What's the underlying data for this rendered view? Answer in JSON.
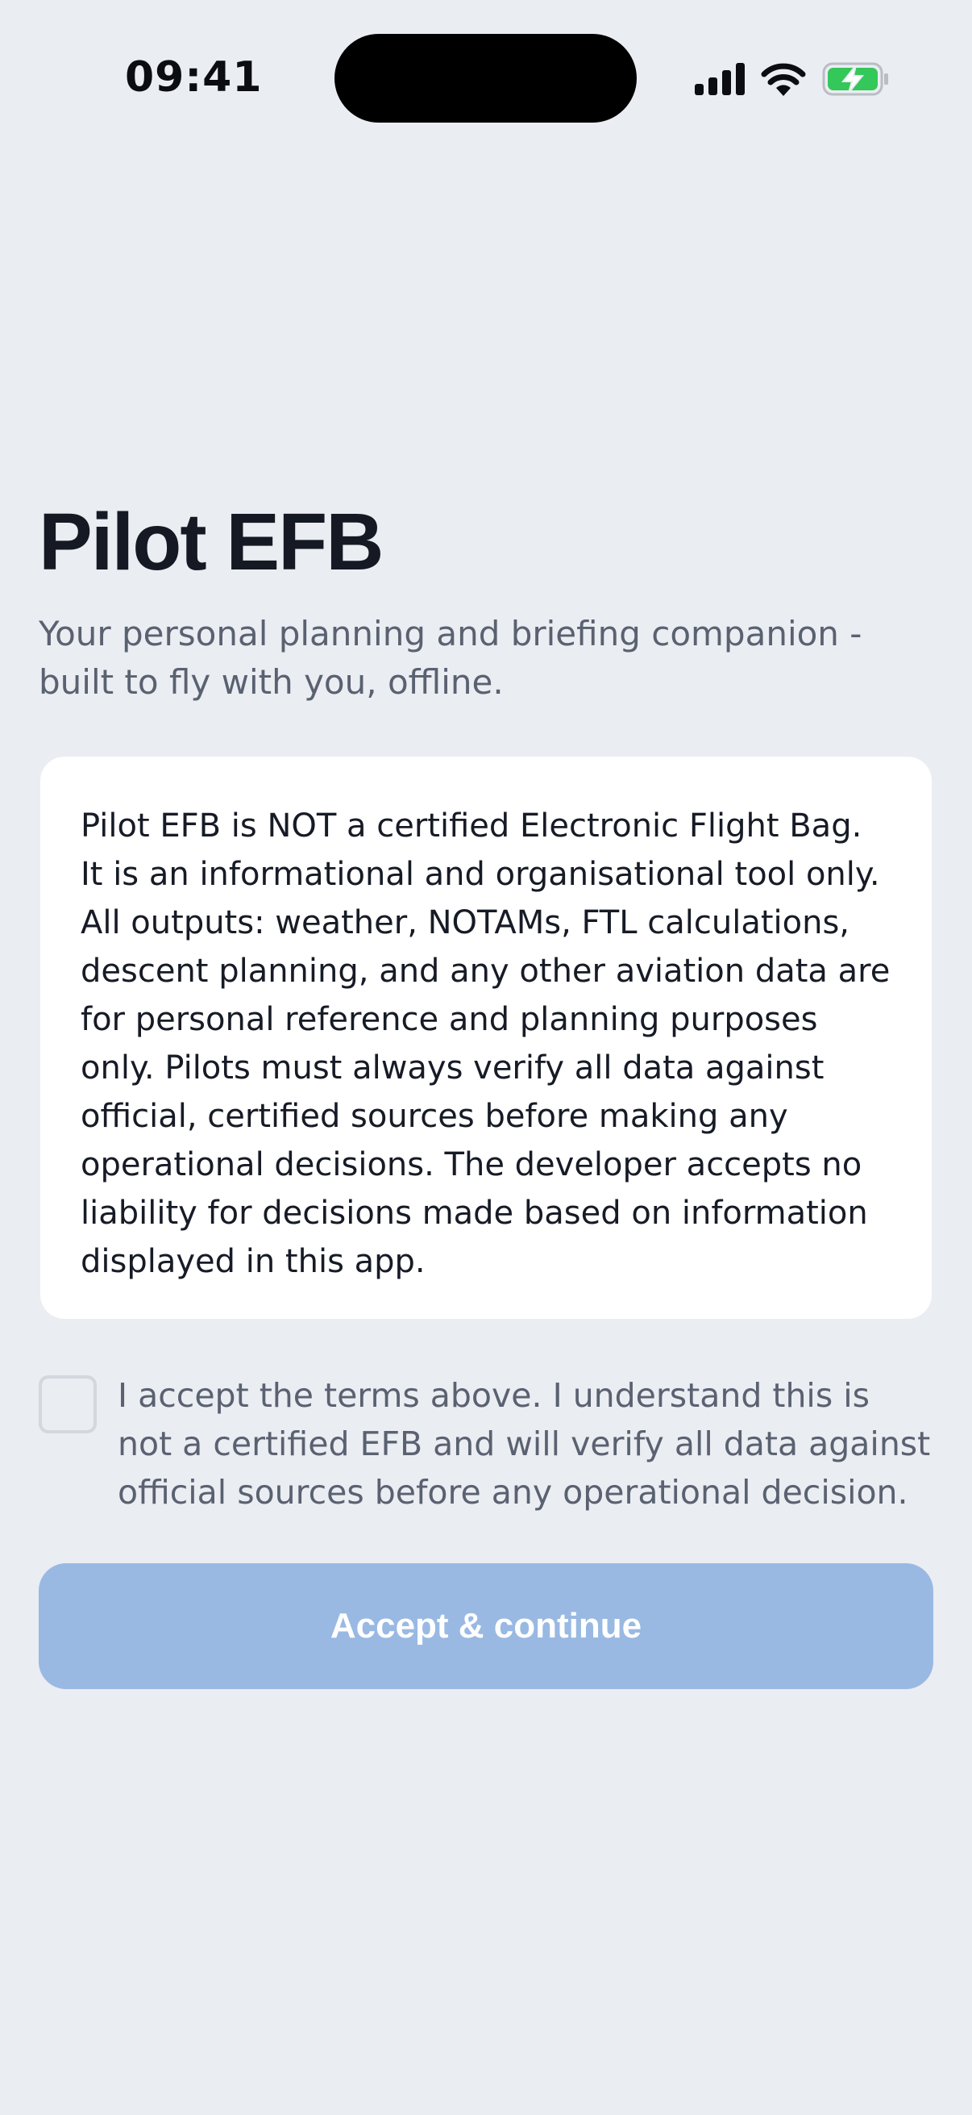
{
  "status_bar": {
    "time": "09:41",
    "icons": [
      "cellular-signal-icon",
      "wifi-icon",
      "battery-charging-icon"
    ],
    "battery_color": "#34c759"
  },
  "header": {
    "title": "Pilot EFB",
    "subtitle": "Your personal planning and briefing companion - built to fly with you, offline."
  },
  "disclaimer": {
    "text": "Pilot EFB is NOT a certified Electronic Flight Bag. It is an informational and organisational tool only. All outputs: weather, NOTAMs, FTL calculations, descent planning, and any other aviation data are for personal reference and planning purposes only. Pilots must always verify all data against official, certified sources before making any operational decisions. The developer accepts no liability for decisions made based on information displayed in this app."
  },
  "acceptance": {
    "checked": false,
    "label": "I accept the terms above. I understand this is not a certified EFB and will verify all data against official sources before any operational decision."
  },
  "actions": {
    "accept_label": "Accept & continue",
    "enabled": false
  },
  "colors": {
    "background": "#eaedf2",
    "card": "#ffffff",
    "title": "#141923",
    "muted_text": "#5a6170",
    "button_disabled": "#99b9e2"
  }
}
